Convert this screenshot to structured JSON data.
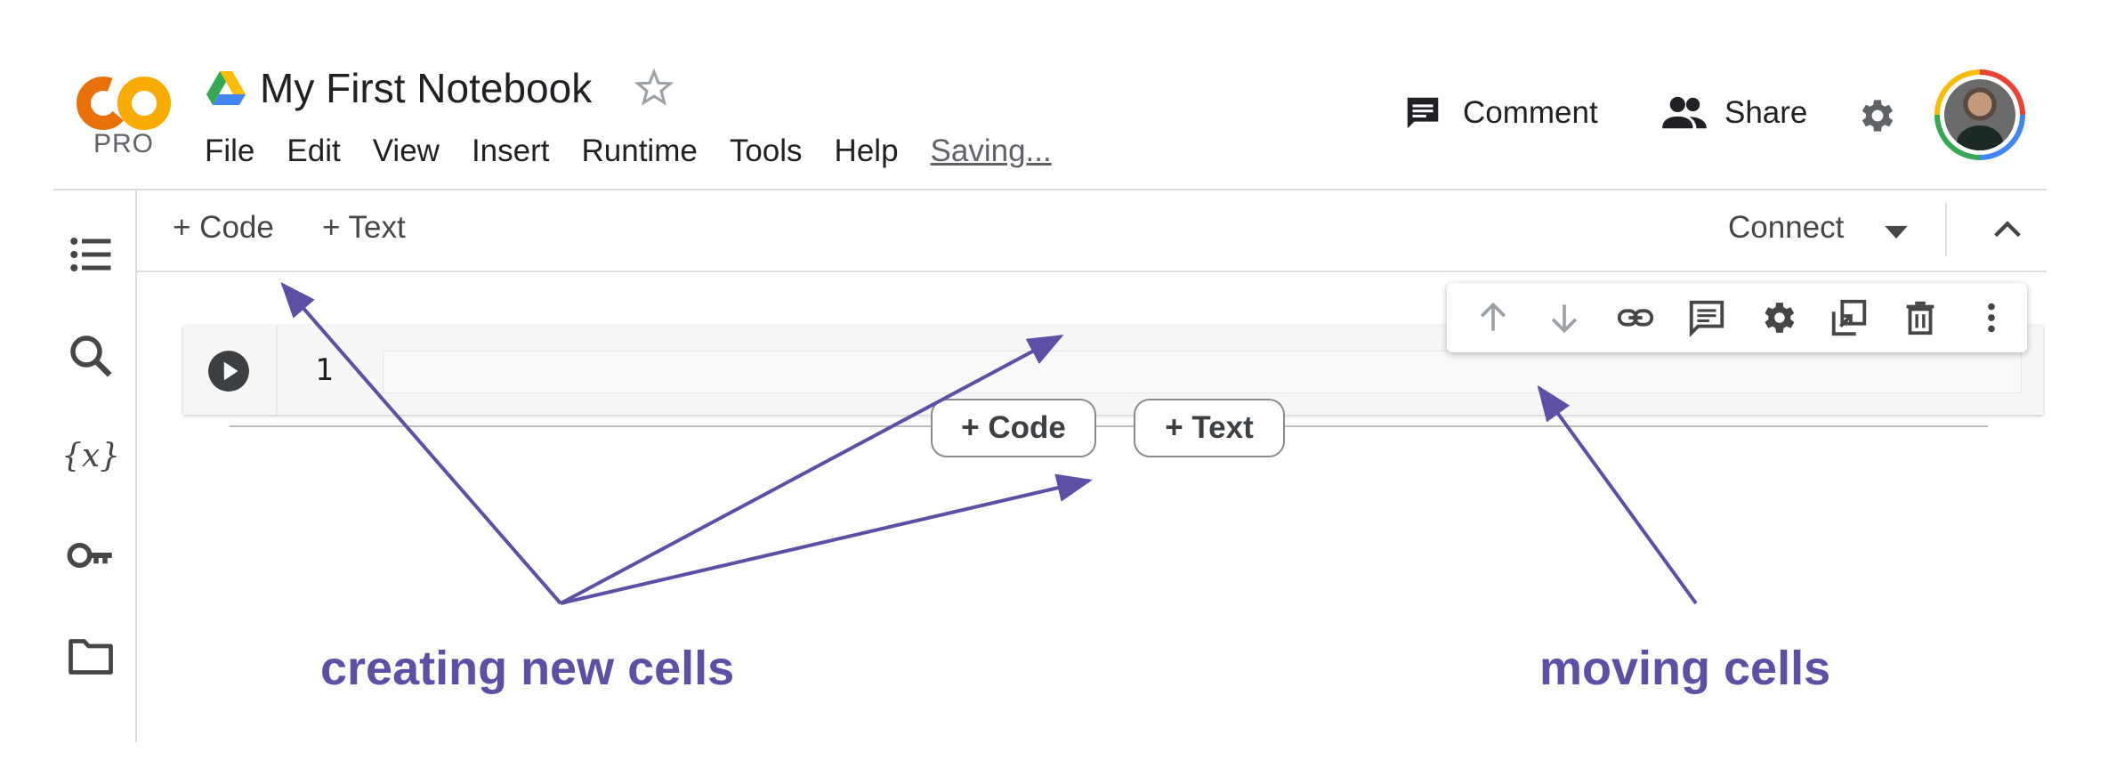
{
  "header": {
    "logo_text": "CO",
    "logo_tier": "PRO",
    "title": "My First Notebook",
    "menu": [
      "File",
      "Edit",
      "View",
      "Insert",
      "Runtime",
      "Tools",
      "Help"
    ],
    "save_status": "Saving...",
    "comment_label": "Comment",
    "share_label": "Share"
  },
  "toolbar": {
    "add_code_label": "+ Code",
    "add_text_label": "+ Text",
    "connect_label": "Connect"
  },
  "cell": {
    "line_number": "1",
    "code": ""
  },
  "add_cell": {
    "code_label": "+ Code",
    "text_label": "+ Text"
  },
  "annotations": {
    "left": "creating new cells",
    "right": "moving cells",
    "color": "#5b4fa6"
  },
  "icons": {
    "sidebar": [
      "table-of-contents-icon",
      "search-icon",
      "variables-icon",
      "secrets-key-icon",
      "files-folder-icon"
    ],
    "cell_toolbar": [
      "move-up-icon",
      "move-down-icon",
      "link-icon",
      "comment-icon",
      "settings-icon",
      "mirror-cell-icon",
      "delete-icon",
      "more-vert-icon"
    ]
  },
  "colors": {
    "logo_orange": "#f9ab00",
    "logo_dark_orange": "#e8710a",
    "annotation": "#5b4fa6",
    "icon_gray": "#444746"
  }
}
